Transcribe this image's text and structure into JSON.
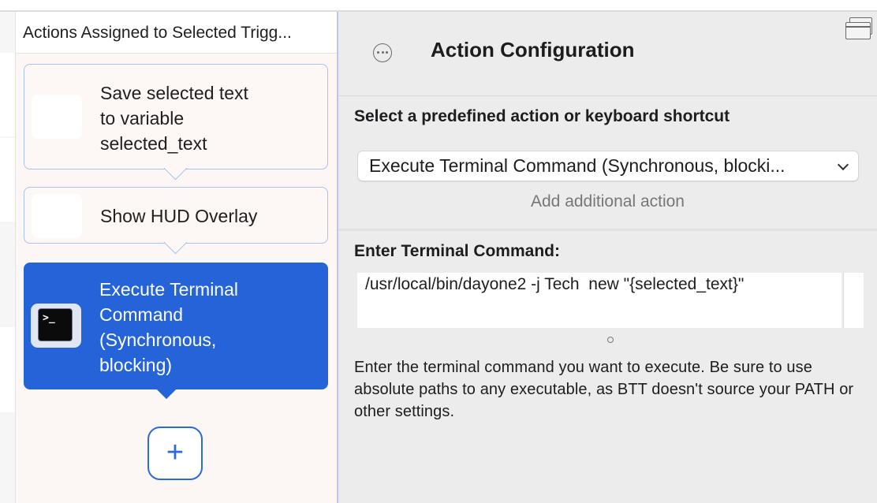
{
  "actions_column": {
    "title": "Actions Assigned to Selected Trigg...",
    "actions": [
      {
        "label_lines": [
          "Save selected text",
          "to variable",
          "selected_text"
        ],
        "selected": false
      },
      {
        "label_lines": [
          "Show HUD Overlay"
        ],
        "selected": false
      },
      {
        "label_lines": [
          "Execute Terminal",
          "Command",
          "(Synchronous,",
          "blocking)"
        ],
        "selected": true,
        "icon": "terminal-icon"
      }
    ],
    "add_button": {
      "label": "+"
    }
  },
  "config": {
    "title": "Action Configuration",
    "predefined_section": {
      "title": "Select a predefined action or keyboard shortcut",
      "selected_value": "Execute Terminal Command (Synchronous, blocki...",
      "add_additional": "Add additional action"
    },
    "terminal_section": {
      "title": "Enter Terminal Command:",
      "command": "/usr/local/bin/dayone2 -j Tech  new \"{selected_text}\"",
      "help_text": "Enter the terminal command you want to execute. Be sure to use absolute paths to any executable, as BTT doesn't source your PATH or other settings."
    }
  },
  "colors": {
    "selected_action_bg": "#2563d9",
    "card_border": "#a9c2ee",
    "accent": "#2d6ad8"
  },
  "icons": [
    "more-options-icon",
    "window-icon",
    "terminal-icon",
    "chevron-down-icon",
    "plus-icon"
  ]
}
